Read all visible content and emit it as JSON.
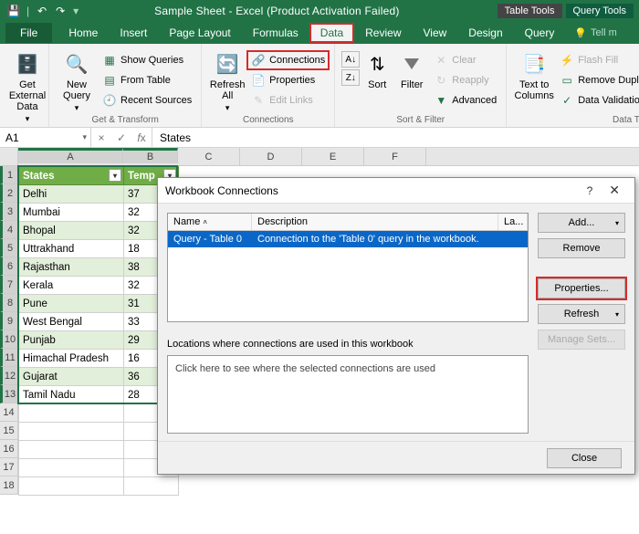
{
  "title": "Sample Sheet - Excel (Product Activation Failed)",
  "tool_tabs": {
    "table": "Table Tools",
    "query": "Query Tools"
  },
  "tabs": {
    "file": "File",
    "home": "Home",
    "insert": "Insert",
    "pagelayout": "Page Layout",
    "formulas": "Formulas",
    "data": "Data",
    "review": "Review",
    "view": "View",
    "design": "Design",
    "query": "Query",
    "tellme": "Tell m"
  },
  "ribbon": {
    "get_external": "Get External\nData",
    "new_query": "New\nQuery",
    "show_queries": "Show Queries",
    "from_table": "From Table",
    "recent_sources": "Recent Sources",
    "refresh_all": "Refresh\nAll",
    "connections_btn": "Connections",
    "properties": "Properties",
    "edit_links": "Edit Links",
    "sort": "Sort",
    "filter": "Filter",
    "clear": "Clear",
    "reapply": "Reapply",
    "advanced": "Advanced",
    "text_to_columns": "Text to\nColumns",
    "flash_fill": "Flash Fill",
    "remove_dupl": "Remove Dupl",
    "data_validation": "Data Validatio",
    "group_transform": "Get & Transform",
    "group_connections": "Connections",
    "group_sort": "Sort & Filter",
    "group_datat": "Data T"
  },
  "namebox": "A1",
  "formula": "States",
  "columns": [
    "A",
    "B",
    "C",
    "D",
    "E",
    "F"
  ],
  "headers": {
    "a": "States",
    "b": "Temp"
  },
  "rows": [
    {
      "a": "Delhi",
      "b": "37"
    },
    {
      "a": "Mumbai",
      "b": "32"
    },
    {
      "a": "Bhopal",
      "b": "32"
    },
    {
      "a": "Uttrakhand",
      "b": "18"
    },
    {
      "a": "Rajasthan",
      "b": "38"
    },
    {
      "a": "Kerala",
      "b": "32"
    },
    {
      "a": "Pune",
      "b": "31"
    },
    {
      "a": "West Bengal",
      "b": "33"
    },
    {
      "a": "Punjab",
      "b": "29"
    },
    {
      "a": "Himachal Pradesh",
      "b": "16"
    },
    {
      "a": "Gujarat",
      "b": "36"
    },
    {
      "a": "Tamil Nadu",
      "b": "28"
    }
  ],
  "rownums": [
    "1",
    "2",
    "3",
    "4",
    "5",
    "6",
    "7",
    "8",
    "9",
    "10",
    "11",
    "12",
    "13",
    "14",
    "15",
    "16",
    "17",
    "18"
  ],
  "dialog": {
    "title": "Workbook Connections",
    "cols": {
      "name": "Name",
      "desc": "Description",
      "last": "La..."
    },
    "row": {
      "name": "Query - Table 0",
      "desc": "Connection to the 'Table 0' query in the workbook."
    },
    "loc_label": "Locations where connections are used in this workbook",
    "loc_text": "Click here to see where the selected connections are used",
    "buttons": {
      "add": "Add...",
      "remove": "Remove",
      "properties": "Properties...",
      "refresh": "Refresh",
      "manage": "Manage Sets...",
      "close": "Close"
    }
  }
}
